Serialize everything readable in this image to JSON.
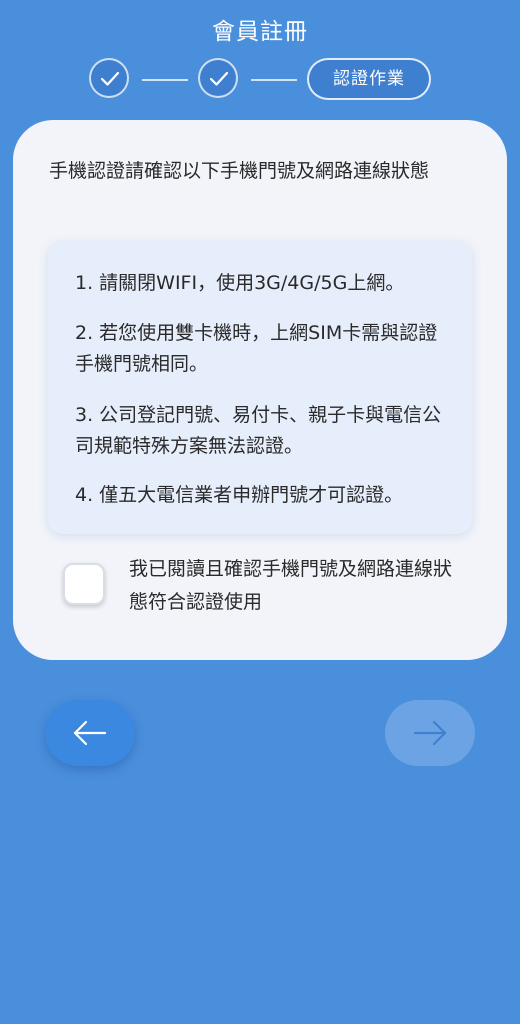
{
  "header": {
    "title": "會員註冊"
  },
  "stepper": {
    "steps": [
      {
        "status": "done",
        "icon": "checkmark-icon"
      },
      {
        "status": "done",
        "icon": "checkmark-icon"
      },
      {
        "status": "current",
        "label": "認證作業"
      }
    ]
  },
  "card": {
    "intro": "手機認證請確認以下手機門號及網路連線狀態",
    "notices": [
      "1. 請關閉WIFI，使用3G/4G/5G上網。",
      "2. 若您使用雙卡機時，上網SIM卡需與認證手機門號相同。",
      "3. 公司登記門號、易付卡、親子卡與電信公司規範特殊方案無法認證。",
      "4. 僅五大電信業者申辦門號才可認證。"
    ],
    "confirm": {
      "checked": false,
      "label": "我已閱讀且確認手機門號及網路連線狀態符合認證使用"
    }
  },
  "navigation": {
    "back_icon": "arrow-left-icon",
    "next_icon": "arrow-right-icon",
    "next_enabled": false
  },
  "colors": {
    "background": "#4a8fdc",
    "card": "#f2f4f9",
    "notice_box": "#e6eefb",
    "back_button": "#3b88e0",
    "next_button_disabled": "#6fa6e6"
  }
}
